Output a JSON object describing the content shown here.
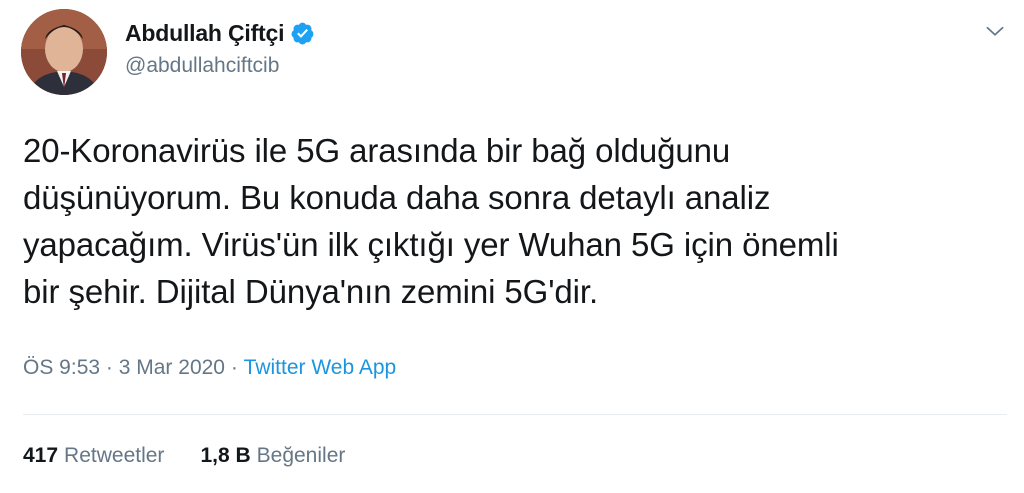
{
  "author": {
    "display_name": "Abdullah Çiftçi",
    "handle": "@abdullahciftcib",
    "verified": true,
    "avatar_icon": "profile-photo"
  },
  "tweet": {
    "text": "20-Koronavirüs ile 5G arasında bir bağ olduğunu\ndüşünüyorum. Bu konuda daha sonra detaylı analiz\nyapacağım. Virüs'ün ilk çıktığı yer Wuhan 5G için önemli\nbir şehir. Dijital Dünya'nın zemini 5G'dir.",
    "time": "ÖS 9:53",
    "date": "3 Mar 2020",
    "separator": "·",
    "source": "Twitter Web App"
  },
  "stats": {
    "retweets_count": "417",
    "retweets_label": "Retweetler",
    "likes_count": "1,8 B",
    "likes_label": "Beğeniler"
  },
  "colors": {
    "accent": "#1b95e0",
    "verified_badge": "#1da1f2",
    "secondary_text": "#657786",
    "primary_text": "#14171a",
    "divider": "#e6ecf0"
  },
  "icons": {
    "verified": "verified-badge-icon",
    "more": "chevron-down-icon"
  }
}
